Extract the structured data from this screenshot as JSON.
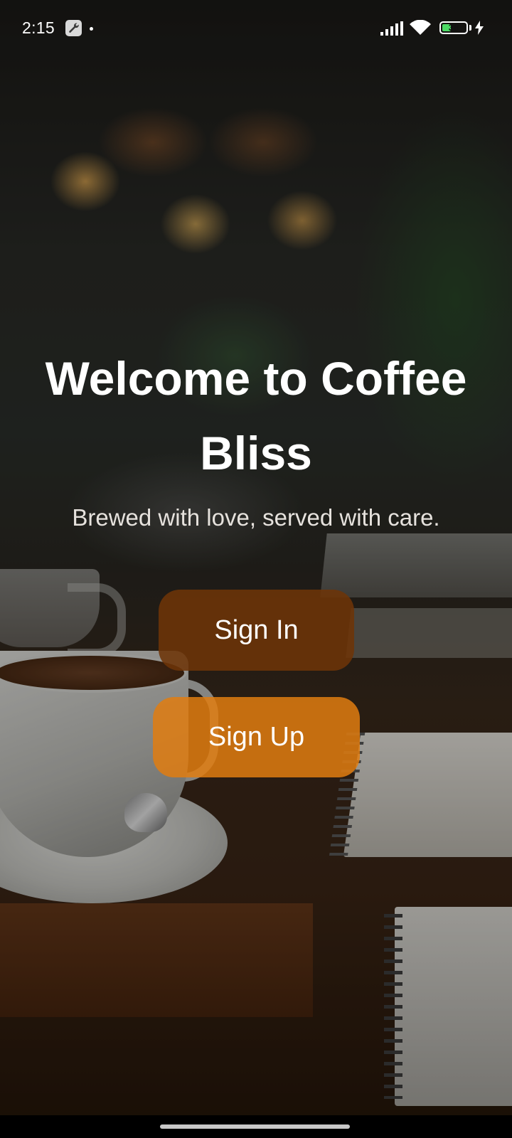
{
  "status_bar": {
    "time": "2:15",
    "battery_level": "38",
    "battery_fraction": 0.38,
    "icons": [
      "wrench-icon",
      "dot-icon",
      "signal-icon",
      "wifi-icon",
      "battery-icon",
      "charging-bolt-icon"
    ]
  },
  "hero": {
    "title": "Welcome to Coffee Bliss",
    "subtitle": "Brewed with love, served with care."
  },
  "actions": {
    "sign_in_label": "Sign In",
    "sign_up_label": "Sign Up"
  },
  "colors": {
    "sign_in_button": "#6d3408",
    "sign_up_button": "#e07c10",
    "text": "#ffffff"
  }
}
